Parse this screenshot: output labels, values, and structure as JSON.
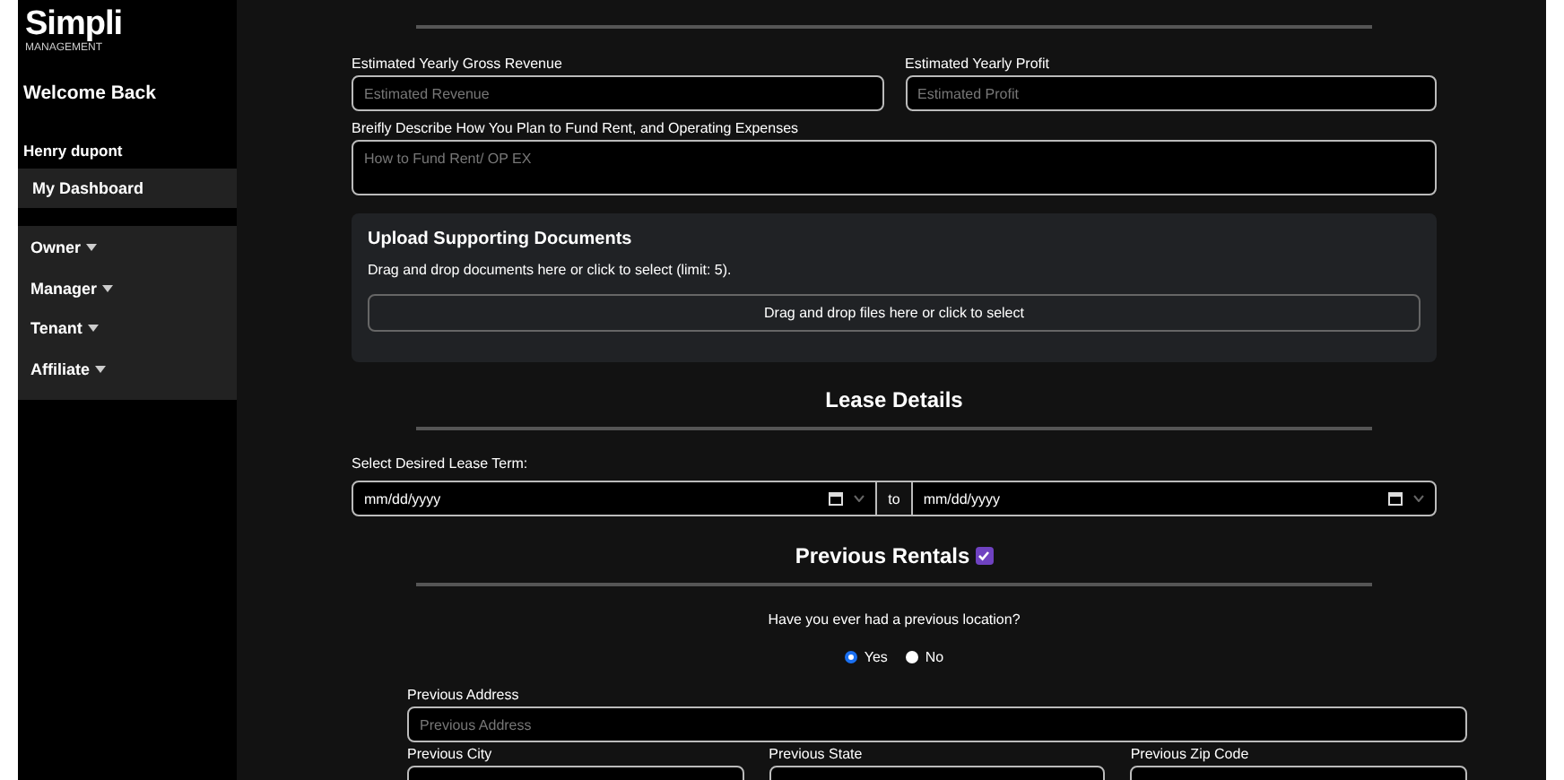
{
  "sidebar": {
    "logo": {
      "name": "Simpli",
      "tagline": "MANAGEMENT"
    },
    "welcome": "Welcome Back",
    "user": "Henry dupont",
    "dashboard": "My Dashboard",
    "menus": [
      {
        "label": "Owner",
        "expanded": false
      },
      {
        "label": "Manager",
        "expanded": false
      },
      {
        "label": "Tenant",
        "expanded": false
      },
      {
        "label": "Affiliate",
        "expanded": false
      }
    ]
  },
  "financial": {
    "fields": [
      {
        "kind": "input",
        "label": "Estimated Yearly Gross Revenue",
        "placeholder": "Estimated Revenue"
      },
      {
        "kind": "input",
        "label": "Estimated Yearly Profit",
        "placeholder": "Estimated Profit"
      },
      {
        "kind": "textarea",
        "label": "Breifly Describe How You Plan to Fund Rent, and Operating Expenses",
        "placeholder": "How to Fund Rent/ OP EX"
      }
    ],
    "upload": {
      "title": "Upload Supporting Documents",
      "description": "Drag and drop documents here or click to select (limit: 5).",
      "dropzone": "Drag and drop files here or click to select"
    }
  },
  "lease": {
    "heading": "Lease Details",
    "label": "Select Desired Lease Term:",
    "start": "mm/dd/yyyy",
    "joiner": "to",
    "end": "mm/dd/yyyy"
  },
  "previous_rentals": {
    "heading": "Previous Rentals",
    "checked": true,
    "question": "Have you ever had a previous location?",
    "options": [
      {
        "label": "Yes",
        "selected": true
      },
      {
        "label": "No",
        "selected": false
      }
    ],
    "address": {
      "label": "Previous Address",
      "placeholder": "Previous Address"
    },
    "row_labels": [
      "Previous City",
      "Previous State",
      "Previous Zip Code"
    ]
  }
}
